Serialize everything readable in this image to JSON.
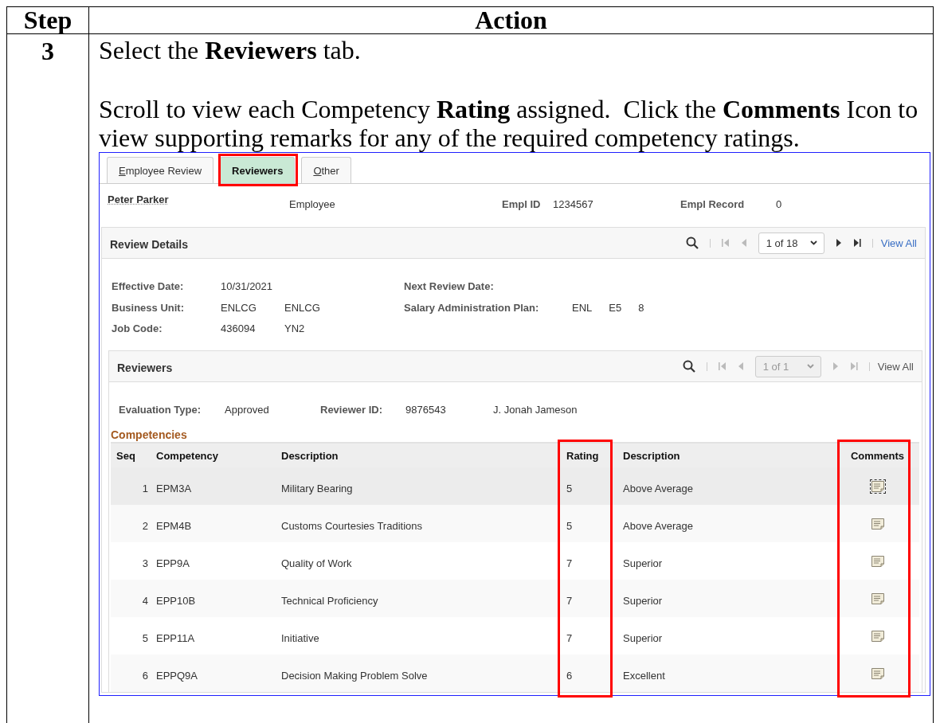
{
  "doc_table": {
    "columns": [
      "Step",
      "Action"
    ],
    "step": "3",
    "instructions": [
      "Select the **Reviewers** tab.",
      "Scroll to view each Competency **Rating** assigned.  Click the **Comments** Icon to view supporting remarks for any of the required competency ratings."
    ]
  },
  "screenshot": {
    "tabs": [
      {
        "label": "Employee Review",
        "selected": false,
        "highlighted": false
      },
      {
        "label": "Reviewers",
        "selected": true,
        "highlighted": true
      },
      {
        "label": "Other",
        "selected": false,
        "highlighted": false
      }
    ],
    "employee": {
      "name": "Peter Parker",
      "role": "Employee",
      "id_label": "Empl ID",
      "id": "1234567",
      "record_label": "Empl Record",
      "record": "0"
    },
    "review_details": {
      "title": "Review Details",
      "pager": {
        "value": "1 of 18",
        "disabled": false,
        "view_all": "View All"
      },
      "fields": [
        {
          "label": "Effective Date:",
          "values": [
            "10/31/2021"
          ],
          "label2": "Next Review Date:"
        },
        {
          "label": "Business Unit:",
          "values": [
            "ENLCG",
            "ENLCG"
          ],
          "label2": "Salary Administration Plan:",
          "values2": [
            "ENL",
            "E5",
            "8"
          ]
        },
        {
          "label": "Job Code:",
          "values": [
            "436094",
            "YN2"
          ]
        }
      ]
    },
    "reviewers": {
      "title": "Reviewers",
      "pager": {
        "value": "1 of 1",
        "disabled": true,
        "view_all": "View All"
      },
      "evaluation_label": "Evaluation Type:",
      "evaluation": "Approved",
      "reviewer_id_label": "Reviewer ID:",
      "reviewer_id": "9876543",
      "reviewer_name": "J. Jonah Jameson"
    },
    "competencies": {
      "title": "Competencies",
      "columns": [
        {
          "label": "Seq",
          "highlighted": false
        },
        {
          "label": "Competency",
          "highlighted": false
        },
        {
          "label": "Description",
          "highlighted": false
        },
        {
          "label": "Rating",
          "highlighted": true
        },
        {
          "label": "Description",
          "highlighted": false
        },
        {
          "label": "Comments",
          "highlighted": true
        }
      ],
      "rows": [
        {
          "seq": "1",
          "competency": "EPM3A",
          "description": "Military Bearing",
          "rating": "5",
          "rating_description": "Above Average",
          "selected": true
        },
        {
          "seq": "2",
          "competency": "EPM4B",
          "description": "Customs Courtesies Traditions",
          "rating": "5",
          "rating_description": "Above Average",
          "selected": false
        },
        {
          "seq": "3",
          "competency": "EPP9A",
          "description": "Quality of Work",
          "rating": "7",
          "rating_description": "Superior",
          "selected": false
        },
        {
          "seq": "4",
          "competency": "EPP10B",
          "description": "Technical Proficiency",
          "rating": "7",
          "rating_description": "Superior",
          "selected": false
        },
        {
          "seq": "5",
          "competency": "EPP11A",
          "description": "Initiative",
          "rating": "7",
          "rating_description": "Superior",
          "selected": false
        },
        {
          "seq": "6",
          "competency": "EPPQ9A",
          "description": "Decision Making Problem Solve",
          "rating": "6",
          "rating_description": "Excellent",
          "selected": false
        }
      ]
    }
  }
}
